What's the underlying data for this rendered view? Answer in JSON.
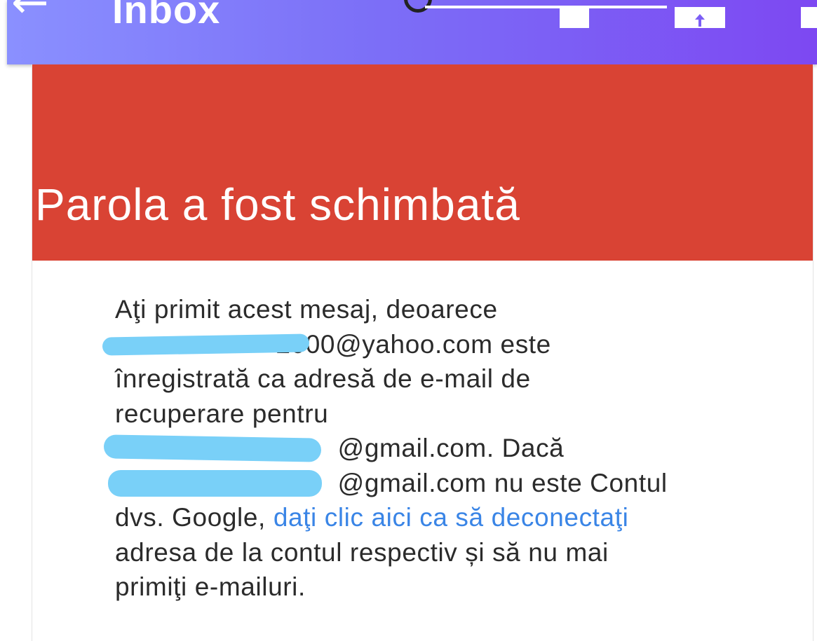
{
  "appbar": {
    "title": "Inbox",
    "back_icon": "←",
    "colors": {
      "gradient_start": "#8a90ff",
      "gradient_end": "#7d48f2"
    }
  },
  "email": {
    "banner_color": "#d94334",
    "banner_title": "Parola a fost schimbată",
    "line1": "Aţi primit acest mesaj, deoarece",
    "line2_tail": "2000@yahoo.com este",
    "line3": "înregistrată ca adresă de e-mail de",
    "line4": "recuperare pentru",
    "line5_tail": "@gmail.com. Dacă",
    "line6_tail": "@gmail.com nu este Contul",
    "line7_prefix": "dvs. Google, ",
    "link_text": "daţi clic aici ca să deconectaţi",
    "line8": "adresa de la contul respectiv și să nu mai",
    "line9": "primiţi e-mailuri.",
    "link_color": "#3a85e6"
  }
}
